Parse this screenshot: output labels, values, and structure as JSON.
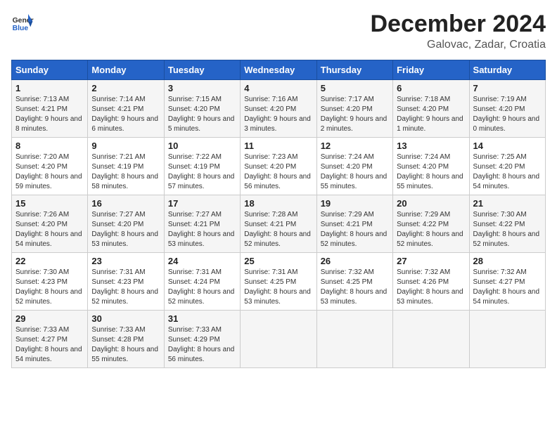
{
  "header": {
    "logo_general": "General",
    "logo_blue": "Blue",
    "month_year": "December 2024",
    "location": "Galovac, Zadar, Croatia"
  },
  "days_of_week": [
    "Sunday",
    "Monday",
    "Tuesday",
    "Wednesday",
    "Thursday",
    "Friday",
    "Saturday"
  ],
  "weeks": [
    [
      {
        "day": "1",
        "sunrise": "Sunrise: 7:13 AM",
        "sunset": "Sunset: 4:21 PM",
        "daylight": "Daylight: 9 hours and 8 minutes."
      },
      {
        "day": "2",
        "sunrise": "Sunrise: 7:14 AM",
        "sunset": "Sunset: 4:21 PM",
        "daylight": "Daylight: 9 hours and 6 minutes."
      },
      {
        "day": "3",
        "sunrise": "Sunrise: 7:15 AM",
        "sunset": "Sunset: 4:20 PM",
        "daylight": "Daylight: 9 hours and 5 minutes."
      },
      {
        "day": "4",
        "sunrise": "Sunrise: 7:16 AM",
        "sunset": "Sunset: 4:20 PM",
        "daylight": "Daylight: 9 hours and 3 minutes."
      },
      {
        "day": "5",
        "sunrise": "Sunrise: 7:17 AM",
        "sunset": "Sunset: 4:20 PM",
        "daylight": "Daylight: 9 hours and 2 minutes."
      },
      {
        "day": "6",
        "sunrise": "Sunrise: 7:18 AM",
        "sunset": "Sunset: 4:20 PM",
        "daylight": "Daylight: 9 hours and 1 minute."
      },
      {
        "day": "7",
        "sunrise": "Sunrise: 7:19 AM",
        "sunset": "Sunset: 4:20 PM",
        "daylight": "Daylight: 9 hours and 0 minutes."
      }
    ],
    [
      {
        "day": "8",
        "sunrise": "Sunrise: 7:20 AM",
        "sunset": "Sunset: 4:20 PM",
        "daylight": "Daylight: 8 hours and 59 minutes."
      },
      {
        "day": "9",
        "sunrise": "Sunrise: 7:21 AM",
        "sunset": "Sunset: 4:19 PM",
        "daylight": "Daylight: 8 hours and 58 minutes."
      },
      {
        "day": "10",
        "sunrise": "Sunrise: 7:22 AM",
        "sunset": "Sunset: 4:19 PM",
        "daylight": "Daylight: 8 hours and 57 minutes."
      },
      {
        "day": "11",
        "sunrise": "Sunrise: 7:23 AM",
        "sunset": "Sunset: 4:20 PM",
        "daylight": "Daylight: 8 hours and 56 minutes."
      },
      {
        "day": "12",
        "sunrise": "Sunrise: 7:24 AM",
        "sunset": "Sunset: 4:20 PM",
        "daylight": "Daylight: 8 hours and 55 minutes."
      },
      {
        "day": "13",
        "sunrise": "Sunrise: 7:24 AM",
        "sunset": "Sunset: 4:20 PM",
        "daylight": "Daylight: 8 hours and 55 minutes."
      },
      {
        "day": "14",
        "sunrise": "Sunrise: 7:25 AM",
        "sunset": "Sunset: 4:20 PM",
        "daylight": "Daylight: 8 hours and 54 minutes."
      }
    ],
    [
      {
        "day": "15",
        "sunrise": "Sunrise: 7:26 AM",
        "sunset": "Sunset: 4:20 PM",
        "daylight": "Daylight: 8 hours and 54 minutes."
      },
      {
        "day": "16",
        "sunrise": "Sunrise: 7:27 AM",
        "sunset": "Sunset: 4:20 PM",
        "daylight": "Daylight: 8 hours and 53 minutes."
      },
      {
        "day": "17",
        "sunrise": "Sunrise: 7:27 AM",
        "sunset": "Sunset: 4:21 PM",
        "daylight": "Daylight: 8 hours and 53 minutes."
      },
      {
        "day": "18",
        "sunrise": "Sunrise: 7:28 AM",
        "sunset": "Sunset: 4:21 PM",
        "daylight": "Daylight: 8 hours and 52 minutes."
      },
      {
        "day": "19",
        "sunrise": "Sunrise: 7:29 AM",
        "sunset": "Sunset: 4:21 PM",
        "daylight": "Daylight: 8 hours and 52 minutes."
      },
      {
        "day": "20",
        "sunrise": "Sunrise: 7:29 AM",
        "sunset": "Sunset: 4:22 PM",
        "daylight": "Daylight: 8 hours and 52 minutes."
      },
      {
        "day": "21",
        "sunrise": "Sunrise: 7:30 AM",
        "sunset": "Sunset: 4:22 PM",
        "daylight": "Daylight: 8 hours and 52 minutes."
      }
    ],
    [
      {
        "day": "22",
        "sunrise": "Sunrise: 7:30 AM",
        "sunset": "Sunset: 4:23 PM",
        "daylight": "Daylight: 8 hours and 52 minutes."
      },
      {
        "day": "23",
        "sunrise": "Sunrise: 7:31 AM",
        "sunset": "Sunset: 4:23 PM",
        "daylight": "Daylight: 8 hours and 52 minutes."
      },
      {
        "day": "24",
        "sunrise": "Sunrise: 7:31 AM",
        "sunset": "Sunset: 4:24 PM",
        "daylight": "Daylight: 8 hours and 52 minutes."
      },
      {
        "day": "25",
        "sunrise": "Sunrise: 7:31 AM",
        "sunset": "Sunset: 4:25 PM",
        "daylight": "Daylight: 8 hours and 53 minutes."
      },
      {
        "day": "26",
        "sunrise": "Sunrise: 7:32 AM",
        "sunset": "Sunset: 4:25 PM",
        "daylight": "Daylight: 8 hours and 53 minutes."
      },
      {
        "day": "27",
        "sunrise": "Sunrise: 7:32 AM",
        "sunset": "Sunset: 4:26 PM",
        "daylight": "Daylight: 8 hours and 53 minutes."
      },
      {
        "day": "28",
        "sunrise": "Sunrise: 7:32 AM",
        "sunset": "Sunset: 4:27 PM",
        "daylight": "Daylight: 8 hours and 54 minutes."
      }
    ],
    [
      {
        "day": "29",
        "sunrise": "Sunrise: 7:33 AM",
        "sunset": "Sunset: 4:27 PM",
        "daylight": "Daylight: 8 hours and 54 minutes."
      },
      {
        "day": "30",
        "sunrise": "Sunrise: 7:33 AM",
        "sunset": "Sunset: 4:28 PM",
        "daylight": "Daylight: 8 hours and 55 minutes."
      },
      {
        "day": "31",
        "sunrise": "Sunrise: 7:33 AM",
        "sunset": "Sunset: 4:29 PM",
        "daylight": "Daylight: 8 hours and 56 minutes."
      },
      null,
      null,
      null,
      null
    ]
  ]
}
